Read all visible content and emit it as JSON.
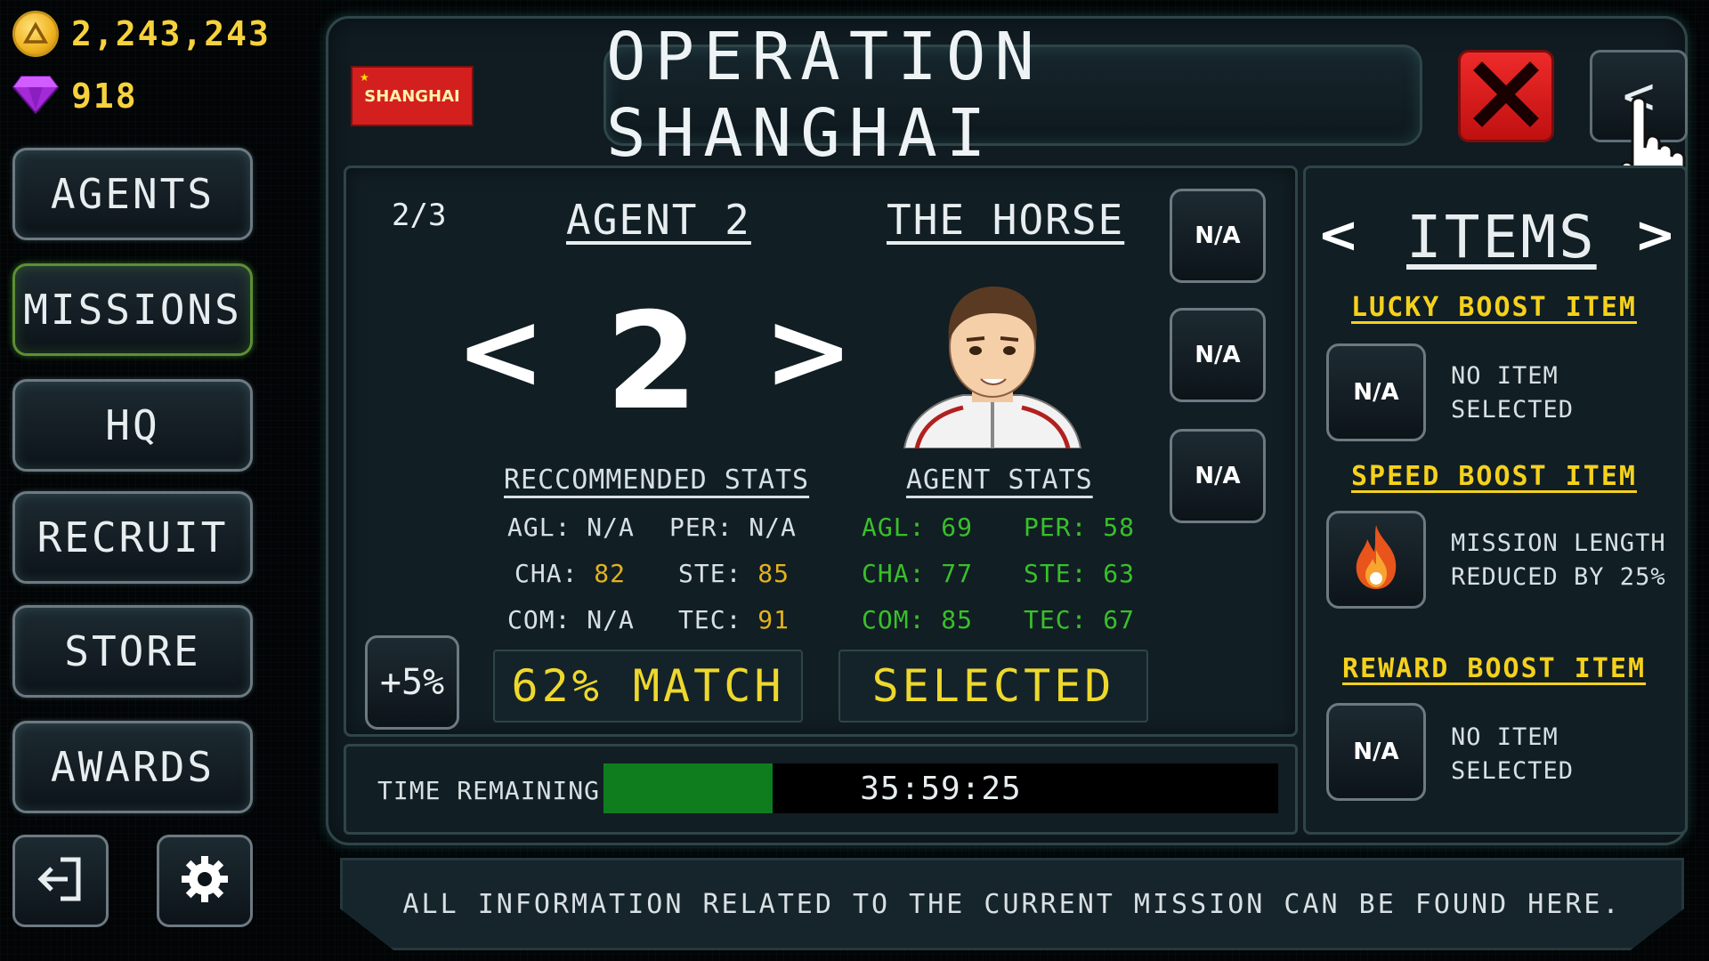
{
  "currency": {
    "coins": "2,243,243",
    "gems": "918",
    "coin_icon": "coin-icon",
    "gem_icon": "gem-icon"
  },
  "nav": {
    "items": [
      {
        "label": "AGENTS",
        "active": false
      },
      {
        "label": "MISSIONS",
        "active": true
      },
      {
        "label": "HQ",
        "active": false
      },
      {
        "label": "RECRUIT",
        "active": false
      },
      {
        "label": "STORE",
        "active": false
      },
      {
        "label": "AWARDS",
        "active": false
      }
    ],
    "exit_icon": "exit-icon",
    "settings_icon": "gear-icon"
  },
  "mission": {
    "flag_label": "SHANGHAI",
    "title": "OPERATION SHANGHAI",
    "back_label": "<"
  },
  "agent": {
    "count": "2/3",
    "label": "AGENT 2",
    "name": "THE HORSE",
    "number": "2",
    "prev": "<",
    "next": ">",
    "slots": [
      "N/A",
      "N/A",
      "N/A"
    ]
  },
  "recommended": {
    "heading": "RECCOMMENDED STATS",
    "stats": [
      {
        "key": "AGL:",
        "value": "N/A"
      },
      {
        "key": "PER:",
        "value": "N/A"
      },
      {
        "key": "CHA:",
        "value": "82"
      },
      {
        "key": "STE:",
        "value": "85"
      },
      {
        "key": "COM:",
        "value": "N/A"
      },
      {
        "key": "TEC:",
        "value": "91"
      }
    ]
  },
  "agent_stats": {
    "heading": "AGENT STATS",
    "stats": [
      {
        "key": "AGL:",
        "value": "69"
      },
      {
        "key": "PER:",
        "value": "58"
      },
      {
        "key": "CHA:",
        "value": "77"
      },
      {
        "key": "STE:",
        "value": "63"
      },
      {
        "key": "COM:",
        "value": "85"
      },
      {
        "key": "TEC:",
        "value": "67"
      }
    ]
  },
  "boost_label": "+5%",
  "match_label": "62% MATCH",
  "selected_label": "SELECTED",
  "time": {
    "label": "TIME REMAINING:",
    "value": "35:59:25",
    "progress": 0.25
  },
  "items": {
    "title": "ITEMS",
    "prev": "<",
    "next": ">",
    "list": [
      {
        "heading": "LUCKY BOOST ITEM",
        "slot": "N/A",
        "desc_line1": "NO ITEM",
        "desc_line2": "SELECTED"
      },
      {
        "heading": "SPEED BOOST ITEM",
        "icon": "flame-icon",
        "desc_line1": "MISSION LENGTH",
        "desc_line2": "REDUCED BY 25%"
      },
      {
        "heading": "REWARD BOOST ITEM",
        "slot": "N/A",
        "desc_line1": "NO ITEM",
        "desc_line2": "SELECTED"
      }
    ]
  },
  "footer_text": "ALL INFORMATION RELATED TO THE CURRENT MISSION CAN BE FOUND HERE.",
  "colors": {
    "accent_yellow": "#f5d11c",
    "stat_green": "#39c02a",
    "stat_gold": "#e3b21c",
    "close_red": "#e01d1d",
    "progress_green": "#0f7d1e"
  }
}
